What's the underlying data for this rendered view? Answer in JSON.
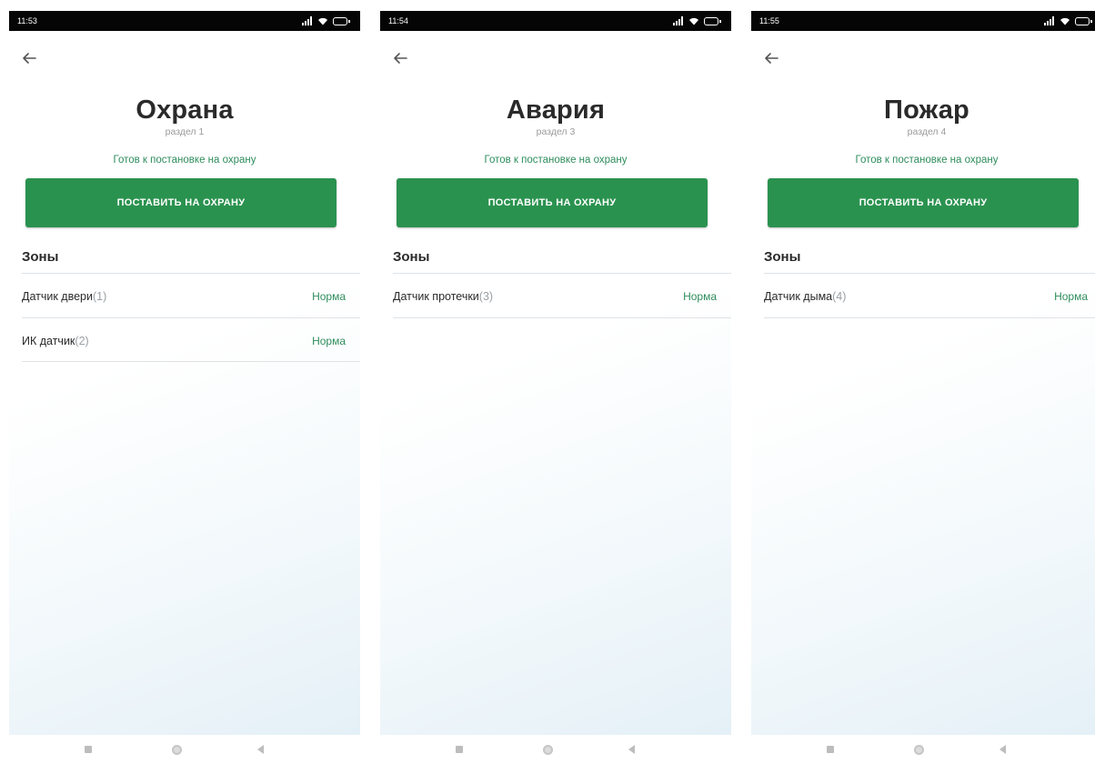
{
  "colors": {
    "accent_green": "#2a924f",
    "status_green": "#2e8c5c",
    "status_bar": "#050505",
    "muted_text": "#9a9a9a"
  },
  "screens": [
    {
      "status": {
        "time": "11:53"
      },
      "back_icon": "arrow-left-icon",
      "title": "Охрана",
      "subtitle": "раздел 1",
      "ready_text": "Готов к постановке на охрану",
      "arm_button": "ПОСТАВИТЬ НА ОХРАНУ",
      "zones_header": "Зоны",
      "zones": [
        {
          "name": "Датчик двери",
          "num": "(1)",
          "status": "Норма"
        },
        {
          "name": "ИК датчик",
          "num": "(2)",
          "status": "Норма"
        }
      ]
    },
    {
      "status": {
        "time": "11:54"
      },
      "back_icon": "arrow-left-icon",
      "title": "Авария",
      "subtitle": "раздел 3",
      "ready_text": "Готов к постановке на охрану",
      "arm_button": "ПОСТАВИТЬ НА ОХРАНУ",
      "zones_header": "Зоны",
      "zones": [
        {
          "name": "Датчик протечки",
          "num": "(3)",
          "status": "Норма"
        }
      ]
    },
    {
      "status": {
        "time": "11:55"
      },
      "back_icon": "arrow-left-icon",
      "title": "Пожар",
      "subtitle": "раздел 4",
      "ready_text": "Готов к постановке на охрану",
      "arm_button": "ПОСТАВИТЬ НА ОХРАНУ",
      "zones_header": "Зоны",
      "zones": [
        {
          "name": "Датчик дыма",
          "num": "(4)",
          "status": "Норма"
        }
      ]
    }
  ],
  "nav_bar_icons": [
    "recents-icon",
    "home-icon",
    "back-nav-icon"
  ]
}
